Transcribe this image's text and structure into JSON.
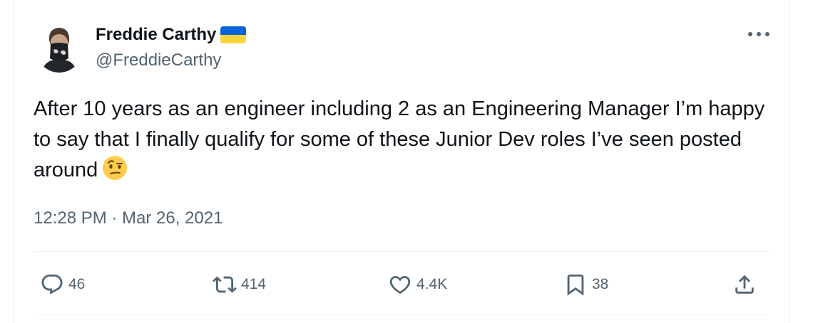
{
  "author": {
    "display_name": "Freddie Carthy",
    "handle": "@FreddieCarthy",
    "flag_icon": "ukraine-flag-icon",
    "flag_colors": [
      "#0A63D8",
      "#FFD43A"
    ]
  },
  "tweet": {
    "text": "After 10 years as an engineer including 2 as an Engineering Manager I’m happy to say that I finally qualify for some of these Junior Dev roles I’ve seen posted around",
    "emoji": "face-with-raised-eyebrow-emoji",
    "timestamp": "12:28 PM · Mar 26, 2021"
  },
  "actions": {
    "replies": "46",
    "retweets": "414",
    "likes": "4.4K",
    "bookmarks": "38"
  },
  "colors": {
    "text": "#0F1419",
    "muted": "#536471",
    "divider": "#EFF3F4"
  }
}
